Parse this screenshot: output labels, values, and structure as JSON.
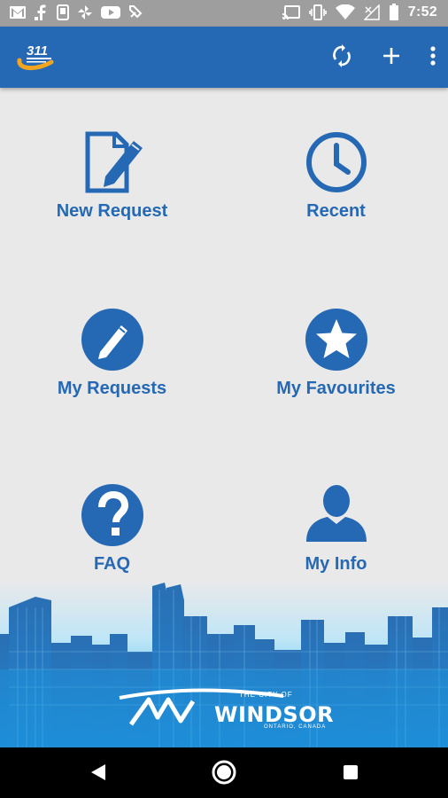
{
  "status_bar": {
    "time": "7:52",
    "left_icons": [
      "gmail-icon",
      "facebook-icon",
      "phone-icon",
      "pinwheel-icon",
      "youtube-icon",
      "feedly-icon"
    ],
    "right_icons": [
      "cast-icon",
      "vibrate-icon",
      "wifi-icon",
      "no-signal-icon",
      "battery-icon"
    ]
  },
  "app_bar": {
    "logo_text": "311",
    "actions": [
      "refresh-icon",
      "add-icon",
      "more-options-icon"
    ]
  },
  "tiles": [
    {
      "label": "New Request",
      "icon": "edit-document-icon"
    },
    {
      "label": "Recent",
      "icon": "clock-icon"
    },
    {
      "label": "My Requests",
      "icon": "pencil-circle-icon"
    },
    {
      "label": "My Favourites",
      "icon": "star-circle-icon"
    },
    {
      "label": "FAQ",
      "icon": "question-circle-icon"
    },
    {
      "label": "My Info",
      "icon": "person-icon"
    }
  ],
  "footer": {
    "city_prefix": "THE CITY OF",
    "city_name": "WINDSOR",
    "region": "ONTARIO, CANADA"
  },
  "nav_bar": {
    "buttons": [
      "back-button",
      "home-button",
      "recents-button"
    ]
  },
  "colors": {
    "primary": "#2568b3",
    "background": "#e9e9e9",
    "status_bar": "#9e9e9e"
  }
}
